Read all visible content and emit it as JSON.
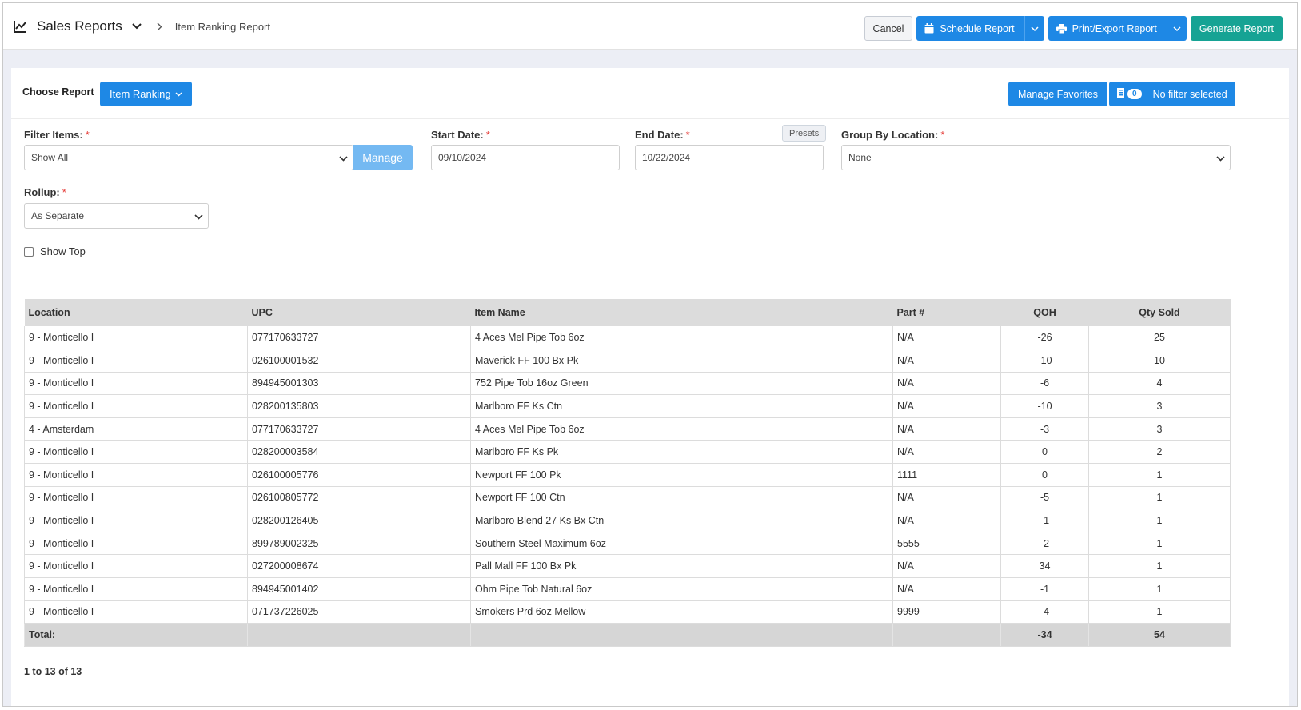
{
  "header": {
    "title": "Sales Reports",
    "breadcrumb": "Item Ranking Report",
    "cancel_label": "Cancel",
    "schedule_label": "Schedule Report",
    "print_label": "Print/Export Report",
    "generate_label": "Generate Report"
  },
  "report": {
    "choose_label": "Choose Report",
    "selected": "Item Ranking",
    "manage_favorites": "Manage Favorites",
    "filter_count": "0",
    "filter_status": "No filter selected"
  },
  "filters": {
    "filter_items_label": "Filter Items:",
    "filter_items_value": "Show All",
    "manage_label": "Manage",
    "start_date_label": "Start Date:",
    "start_date_value": "09/10/2024",
    "end_date_label": "End Date:",
    "end_date_value": "10/22/2024",
    "presets_label": "Presets",
    "group_label": "Group By Location:",
    "group_value": "None",
    "rollup_label": "Rollup:",
    "rollup_value": "As Separate",
    "show_top_label": "Show Top",
    "required_mark": "*"
  },
  "table": {
    "columns": [
      "Location",
      "UPC",
      "Item Name",
      "Part #",
      "QOH",
      "Qty Sold"
    ],
    "rows": [
      [
        "9 - Monticello I",
        "077170633727",
        "4 Aces Mel Pipe Tob 6oz",
        "N/A",
        "-26",
        "25"
      ],
      [
        "9 - Monticello I",
        "026100001532",
        "Maverick FF 100 Bx Pk",
        "N/A",
        "-10",
        "10"
      ],
      [
        "9 - Monticello I",
        "894945001303",
        "752 Pipe Tob 16oz Green",
        "N/A",
        "-6",
        "4"
      ],
      [
        "9 - Monticello I",
        "028200135803",
        "Marlboro FF Ks Ctn",
        "N/A",
        "-10",
        "3"
      ],
      [
        "4 - Amsterdam",
        "077170633727",
        "4 Aces Mel Pipe Tob 6oz",
        "N/A",
        "-3",
        "3"
      ],
      [
        "9 - Monticello I",
        "028200003584",
        "Marlboro FF Ks Pk",
        "N/A",
        "0",
        "2"
      ],
      [
        "9 - Monticello I",
        "026100005776",
        "Newport FF 100 Pk",
        "1111",
        "0",
        "1"
      ],
      [
        "9 - Monticello I",
        "026100805772",
        "Newport FF 100 Ctn",
        "N/A",
        "-5",
        "1"
      ],
      [
        "9 - Monticello I",
        "028200126405",
        "Marlboro Blend 27 Ks Bx Ctn",
        "N/A",
        "-1",
        "1"
      ],
      [
        "9 - Monticello I",
        "899789002325",
        "Southern Steel Maximum 6oz",
        "5555",
        "-2",
        "1"
      ],
      [
        "9 - Monticello I",
        "027200008674",
        "Pall Mall FF 100 Bx Pk",
        "N/A",
        "34",
        "1"
      ],
      [
        "9 - Monticello I",
        "894945001402",
        "Ohm Pipe Tob Natural 6oz",
        "N/A",
        "-1",
        "1"
      ],
      [
        "9 - Monticello I",
        "071737226025",
        "Smokers Prd 6oz Mellow",
        "9999",
        "-4",
        "1"
      ]
    ],
    "total_label": "Total:",
    "total_qoh": "-34",
    "total_qty": "54"
  },
  "pager": "1 to 13 of 13",
  "colors": {
    "primary": "#1e88e5",
    "teal": "#16a394",
    "required": "#e53935"
  }
}
